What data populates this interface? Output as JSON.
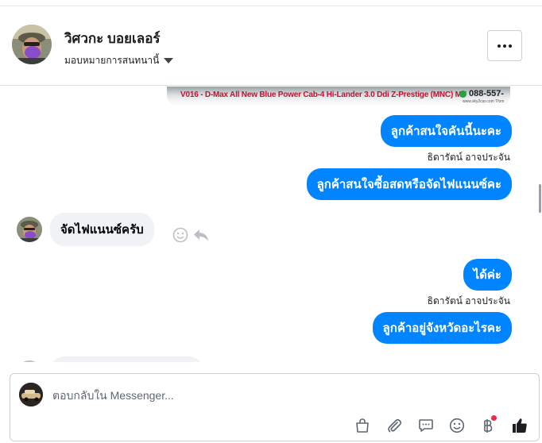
{
  "header": {
    "contact_name": "วิศวกะ บอยเลอร์",
    "assign_label": "มอบหมายการสนทนานี้"
  },
  "banner": {
    "ad_text": "V016 - D-Max All New Blue Power Cab-4 Hi-Lander 3.0 Ddi Z-Prestige (MNC) MT",
    "phone": "088-557-",
    "url": "www.sky2car.com Tfom"
  },
  "messages": [
    {
      "direction": "out",
      "text": "ลูกค้าสนใจคันนี้นะคะ",
      "sender": "ธิดารัตน์ อาจประจัน"
    },
    {
      "direction": "out",
      "text": "ลูกค้าสนใจซื้อสดหรือจัดไฟแนนซ์คะ"
    },
    {
      "direction": "in",
      "text": "จัดไฟแนนซ์ครับ"
    },
    {
      "direction": "out",
      "text": "ได้ค่ะ",
      "sender": "ธิดารัตน์ อาจประจัน"
    },
    {
      "direction": "out",
      "text": "ลูกค้าอยู่จังหวัดอะไรคะ"
    }
  ],
  "composer": {
    "placeholder": "ตอบกลับใน Messenger..."
  },
  "colors": {
    "outgoing_bubble": "#0084ff",
    "incoming_bubble": "#f0f2f5",
    "like_icon": "#1c1e21",
    "notification_dot": "#f02849"
  }
}
